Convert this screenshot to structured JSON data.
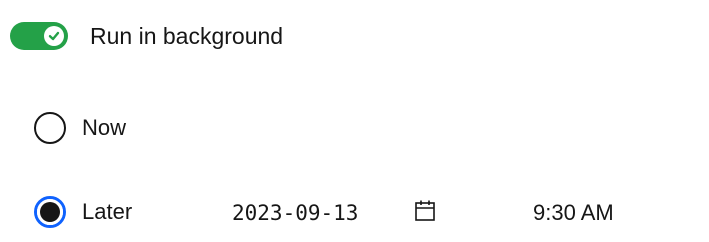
{
  "background_toggle": {
    "label": "Run in background",
    "on": true,
    "color": "#24a148"
  },
  "schedule": {
    "options": [
      {
        "label": "Now",
        "selected": false
      },
      {
        "label": "Later",
        "selected": true
      }
    ],
    "date_value": "2023-09-13",
    "time_value": "9:30 AM",
    "calendar_icon": "calendar-icon",
    "selected_color": "#0f62fe"
  }
}
